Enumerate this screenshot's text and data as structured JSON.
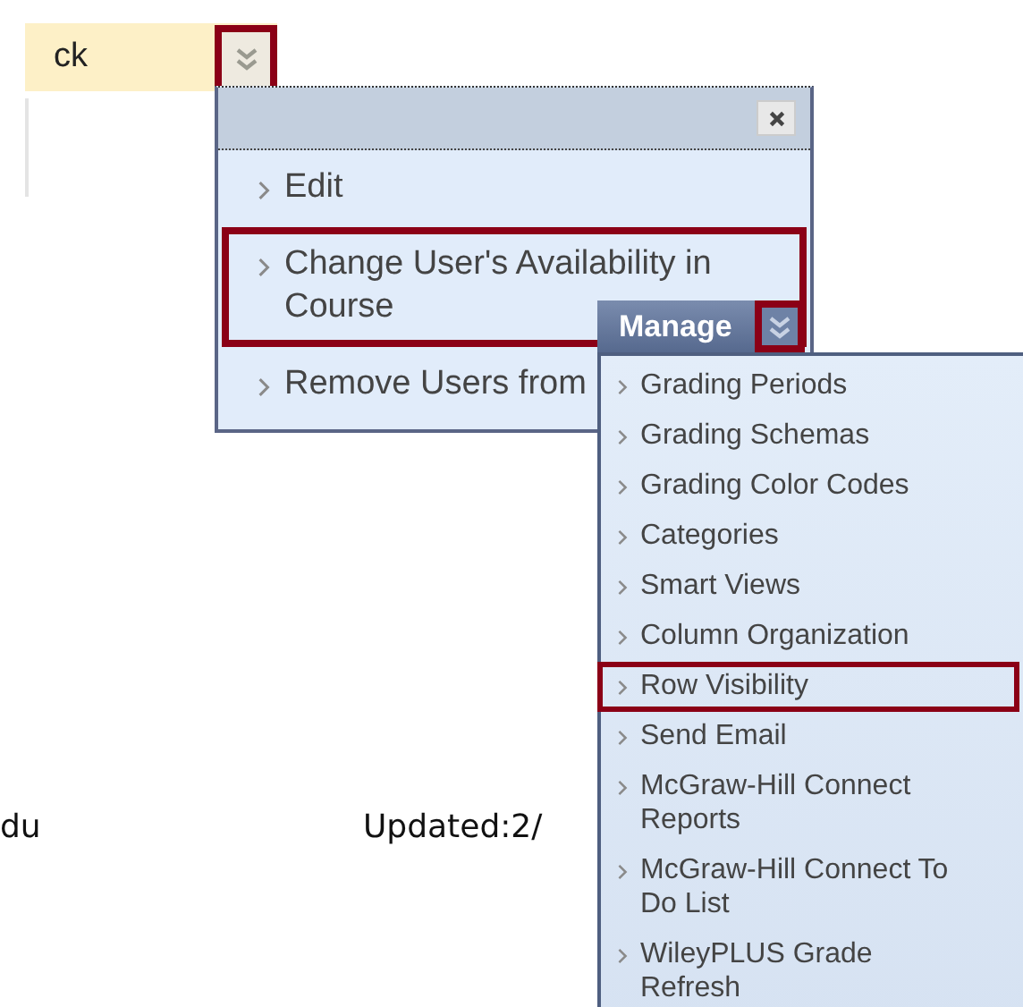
{
  "top_bar": {
    "label": "ck",
    "menu_button_highlighted": true
  },
  "context_menu": {
    "items": [
      {
        "label": "Edit",
        "highlighted": false
      },
      {
        "label": "Change User's Availability in Course",
        "highlighted": true
      },
      {
        "label": "Remove Users from",
        "highlighted": false
      }
    ]
  },
  "manage_menu": {
    "title": "Manage",
    "button_highlighted": true,
    "items": [
      {
        "label": "Grading Periods",
        "highlighted": false
      },
      {
        "label": "Grading Schemas",
        "highlighted": false
      },
      {
        "label": "Grading Color Codes",
        "highlighted": false
      },
      {
        "label": "Categories",
        "highlighted": false
      },
      {
        "label": "Smart Views",
        "highlighted": false
      },
      {
        "label": "Column Organization",
        "highlighted": false
      },
      {
        "label": "Row Visibility",
        "highlighted": true
      },
      {
        "label": "Send Email",
        "highlighted": false
      },
      {
        "label": "McGraw-Hill Connect Reports",
        "highlighted": false
      },
      {
        "label": "McGraw-Hill Connect To Do List",
        "highlighted": false
      },
      {
        "label": "WileyPLUS Grade Refresh",
        "highlighted": false
      }
    ]
  },
  "footer": {
    "left": "du",
    "right": "Updated:2/"
  }
}
